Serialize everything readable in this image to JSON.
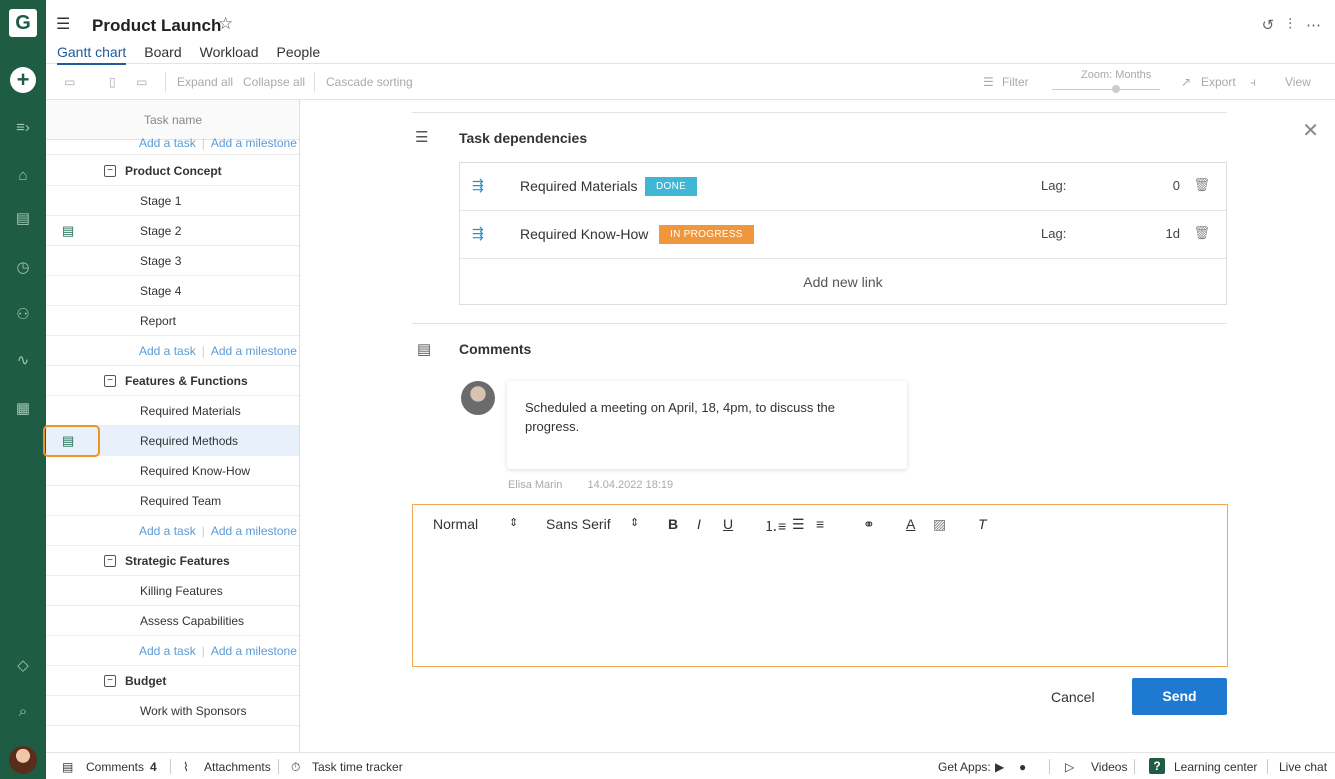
{
  "app": {
    "logo_letter": "G",
    "project_title": "Product Launch"
  },
  "tabs": [
    {
      "label": "Gantt chart",
      "active": true
    },
    {
      "label": "Board",
      "active": false
    },
    {
      "label": "Workload",
      "active": false
    },
    {
      "label": "People",
      "active": false
    }
  ],
  "toolbar": {
    "expand_all": "Expand all",
    "collapse_all": "Collapse all",
    "cascade_sorting": "Cascade sorting",
    "filter": "Filter",
    "zoom": "Zoom: Months",
    "export": "Export",
    "view": "View"
  },
  "task_list": {
    "header": "Task name",
    "add_task": "Add a task",
    "add_milestone": "Add a milestone",
    "groups": [
      {
        "name": "Product Concept",
        "tasks": [
          "Stage 1",
          "Stage 2",
          "Stage 3",
          "Stage 4",
          "Report"
        ]
      },
      {
        "name": "Features & Functions",
        "tasks": [
          "Required Materials",
          "Required Methods",
          "Required Know-How",
          "Required Team"
        ]
      },
      {
        "name": "Strategic Features",
        "tasks": [
          "Killing Features",
          "Assess Capabilities"
        ]
      },
      {
        "name": "Budget",
        "tasks": [
          "Work with Sponsors"
        ]
      }
    ],
    "selected_task": "Required Methods"
  },
  "dependencies": {
    "title": "Task dependencies",
    "items": [
      {
        "name": "Required Materials",
        "status": "DONE",
        "status_color": "#3fb6d3",
        "lag_label": "Lag:",
        "lag": "0"
      },
      {
        "name": "Required Know-How",
        "status": "IN PROGRESS",
        "status_color": "#f0963c",
        "lag_label": "Lag:",
        "lag": "1d"
      }
    ],
    "add_link": "Add new link"
  },
  "comments": {
    "title": "Comments",
    "items": [
      {
        "text": "Scheduled a meeting on April, 18, 4pm, to discuss the progress.",
        "author": "Elisa Marin",
        "date": "14.04.2022 18:19"
      }
    ],
    "editor": {
      "format": "Normal",
      "font": "Sans Serif",
      "bold": "B",
      "italic": "I",
      "underline": "U",
      "font_color": "A"
    },
    "cancel": "Cancel",
    "send": "Send"
  },
  "bottom_bar": {
    "comments": "Comments",
    "comments_count": "4",
    "attachments": "Attachments",
    "time_tracker": "Task time tracker",
    "get_apps": "Get Apps:",
    "videos": "Videos",
    "learning_center": "Learning center",
    "live_chat": "Live chat"
  }
}
